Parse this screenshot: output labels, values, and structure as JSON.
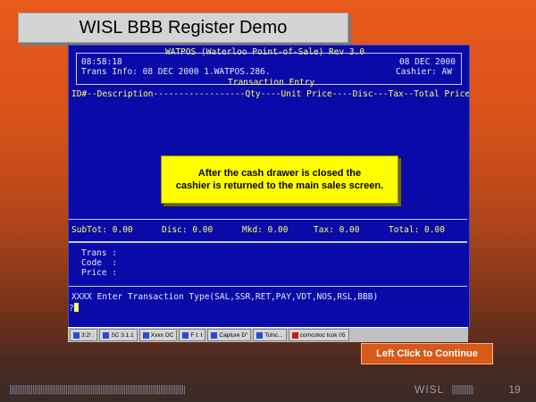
{
  "slide": {
    "title": "WISL BBB Register Demo",
    "continue_label": "Left Click to Continue",
    "footer_brand": "WISL",
    "page_number": "19",
    "bars_left": "||||||||||||||||||||||||||||||||||||||||||||||||||||||||||||||||||||||||||||||||||||||||||||||||||||||||||",
    "bars_right": "|||||||||||||"
  },
  "callout": {
    "line1": "After the cash drawer is closed the",
    "line2": "cashier is returned to the main sales screen."
  },
  "terminal": {
    "header": "WATPOS (Waterloo Point-of-Sale) Rev 3.0",
    "time": "08:58:18",
    "date": "08 DEC 2000",
    "trans_info": "Trans Info: 08 DEC 2000 1.WATPOS.286.",
    "cashier": "Cashier: AW",
    "section": "Transaction Entry",
    "columns": "ID#--Description------------------Qty----Unit Price----Disc---Tax--Total Price",
    "totals": {
      "subtot": "SubTot: 0.00",
      "disc": "Disc: 0.00",
      "mkd": "Mkd: 0.00",
      "tax": "Tax: 0.00",
      "total": "Total: 0.00"
    },
    "trans_label": "Trans :",
    "code_label": "Code  :",
    "price_label": "Price :",
    "prompt": "XXXX Enter Transaction Type(SAL,SSR,RET,PAY,VDT,NOS,RSL,BBB)",
    "cursor_prefix": "?"
  },
  "taskbar": {
    "items": [
      "3:2! :",
      "SC 3.1.1",
      "Xxxx OC",
      "F  t:  t",
      "Capture D\"",
      "Tclnc...",
      "corncotoc  tcok 05"
    ]
  }
}
